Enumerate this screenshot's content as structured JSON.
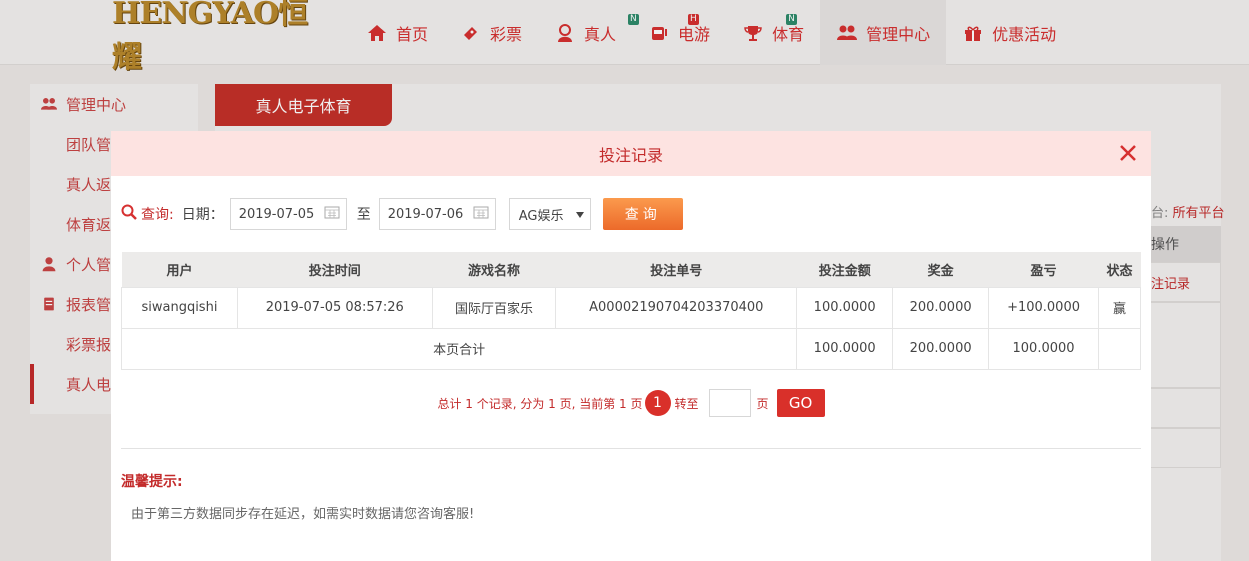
{
  "brand": {
    "logo_text": "HENGYAO恒耀"
  },
  "nav": {
    "items": [
      {
        "label": "首页",
        "icon": "home-icon",
        "badge": ""
      },
      {
        "label": "彩票",
        "icon": "ticket-icon",
        "badge": ""
      },
      {
        "label": "真人",
        "icon": "dealer-icon",
        "badge": "N"
      },
      {
        "label": "电游",
        "icon": "slot-machine-icon",
        "badge": "H"
      },
      {
        "label": "体育",
        "icon": "trophy-icon",
        "badge": "N"
      },
      {
        "label": "管理中心",
        "icon": "users-icon",
        "badge": ""
      },
      {
        "label": "优惠活动",
        "icon": "gift-icon",
        "badge": ""
      }
    ]
  },
  "sidebar": {
    "items": [
      {
        "label": "管理中心",
        "type": "head"
      },
      {
        "label": "团队管",
        "type": "item"
      },
      {
        "label": "真人返",
        "type": "item"
      },
      {
        "label": "体育返",
        "type": "item"
      },
      {
        "label": "个人管",
        "type": "head"
      },
      {
        "label": "报表管",
        "type": "head"
      },
      {
        "label": "彩票报",
        "type": "item"
      },
      {
        "label": "真人电",
        "type": "active"
      }
    ]
  },
  "content": {
    "tab_label": "真人电子体育",
    "platform_prefix": "台:",
    "platform_value": "所有平台",
    "table_head": "操作",
    "row_action": "注记录"
  },
  "modal": {
    "title": "投注记录",
    "query": {
      "label": "查询:",
      "date_label": "日期：",
      "start_date": "2019-07-05",
      "to_label": "至",
      "end_date": "2019-07-06",
      "platform_selected": "AG娱乐",
      "button_label": "查询"
    },
    "table": {
      "headers": [
        "用户",
        "投注时间",
        "游戏名称",
        "投注单号",
        "投注金额",
        "奖金",
        "盈亏",
        "状态"
      ],
      "rows": [
        {
          "user": "siwangqishi",
          "time": "2019-07-05 08:57:26",
          "game": "国际厅百家乐",
          "order": "A00002190704203370400",
          "amount": "100.0000",
          "prize": "200.0000",
          "profit": "+100.0000",
          "status": "赢"
        }
      ],
      "summary": {
        "label": "本页合计",
        "amount": "100.0000",
        "prize": "200.0000",
        "profit": "100.0000"
      }
    },
    "pager": {
      "info": "总计 1 个记录, 分为 1 页, 当前第 1 页",
      "current_page": "1",
      "goto_label": "转至",
      "page_label": "页",
      "go_label": "GO"
    },
    "tips": {
      "title": "温馨提示:",
      "text": "由于第三方数据同步存在延迟，如需实时数据请您咨询客服!"
    }
  },
  "colors": {
    "accent": "#c32b2b",
    "win": "#2e8b2e",
    "query_button": "#f07a35",
    "header_bg": "#fde3e1"
  }
}
